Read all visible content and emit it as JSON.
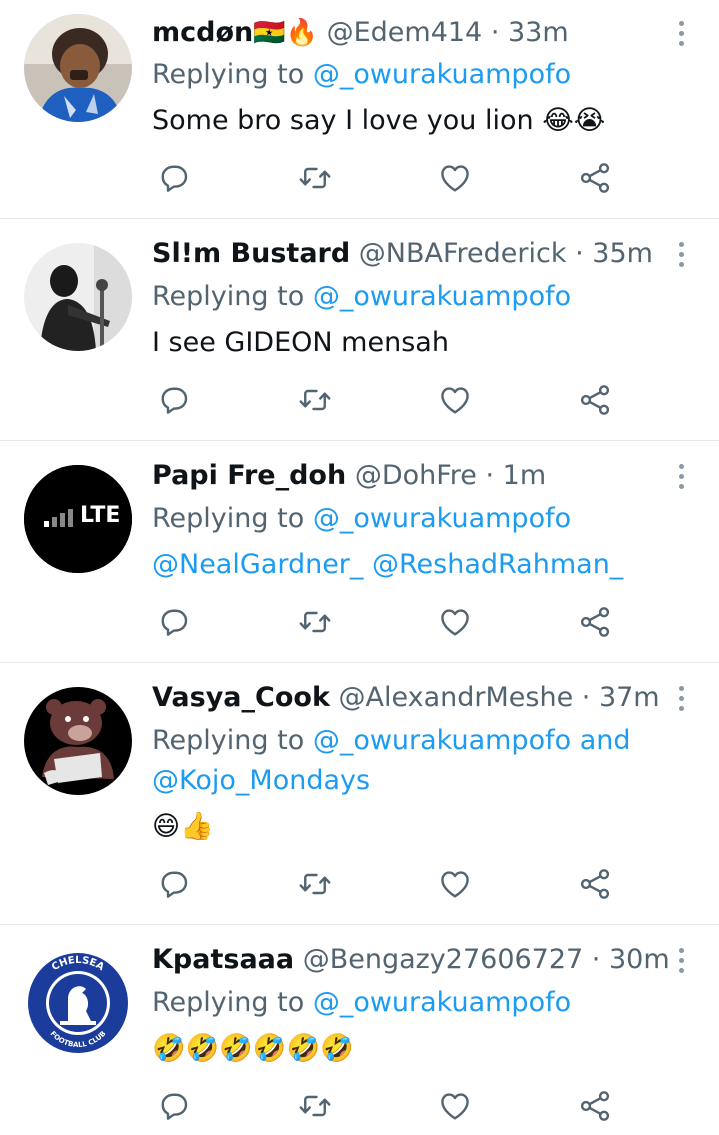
{
  "tweets": [
    {
      "name": "mcdøn",
      "name_emoji": "🇬🇭🔥",
      "handle": "@Edem414",
      "time": "33m",
      "replying_prefix": "Replying to",
      "replying_to": "@_owurakuampofo",
      "text": "Some bro say I love you lion 😂😭",
      "avatar_icon": "child-photo-avatar"
    },
    {
      "name": "Sl!m Bustard",
      "handle": "@NBAFrederick",
      "time": "35m",
      "replying_prefix": "Replying to",
      "replying_to": "@_owurakuampofo",
      "text": "I see GIDEON mensah",
      "avatar_icon": "person-photo-avatar"
    },
    {
      "name": "Papi Fre_doh",
      "handle": "@DohFre",
      "time": "1m",
      "replying_prefix": "Replying to",
      "replying_to": "@_owurakuampofo",
      "mentions": "@NealGardner_ @ReshadRahman_",
      "avatar_text": "LTE",
      "avatar_icon": "lte-signal-avatar"
    },
    {
      "name": "Vasya_Cook",
      "handle": "@AlexandrMeshe",
      "time": "37m",
      "replying_prefix": "Replying to",
      "replying_to": "@_owurakuampofo and",
      "replying_to_2": "@Kojo_Mondays",
      "text": "😄👍",
      "avatar_icon": "bear-cartoon-avatar"
    },
    {
      "name": "Kpatsaaa",
      "handle": "@Bengazy27606727",
      "time": "30m",
      "replying_prefix": "Replying to",
      "replying_to": "@_owurakuampofo",
      "text": "🤣🤣🤣🤣🤣🤣",
      "avatar_icon": "chelsea-crest-avatar",
      "avatar_text_top": "CHELSEA",
      "avatar_text_bottom": "FOOTBALL CLUB"
    }
  ],
  "colors": {
    "link": "#1d9bf0",
    "secondary_text": "#536471",
    "primary_text": "#0f1419",
    "divider": "#e6e9ec",
    "icon": "#536471"
  },
  "icons": [
    "reply-icon",
    "retweet-icon",
    "like-icon",
    "share-icon",
    "more-icon"
  ]
}
